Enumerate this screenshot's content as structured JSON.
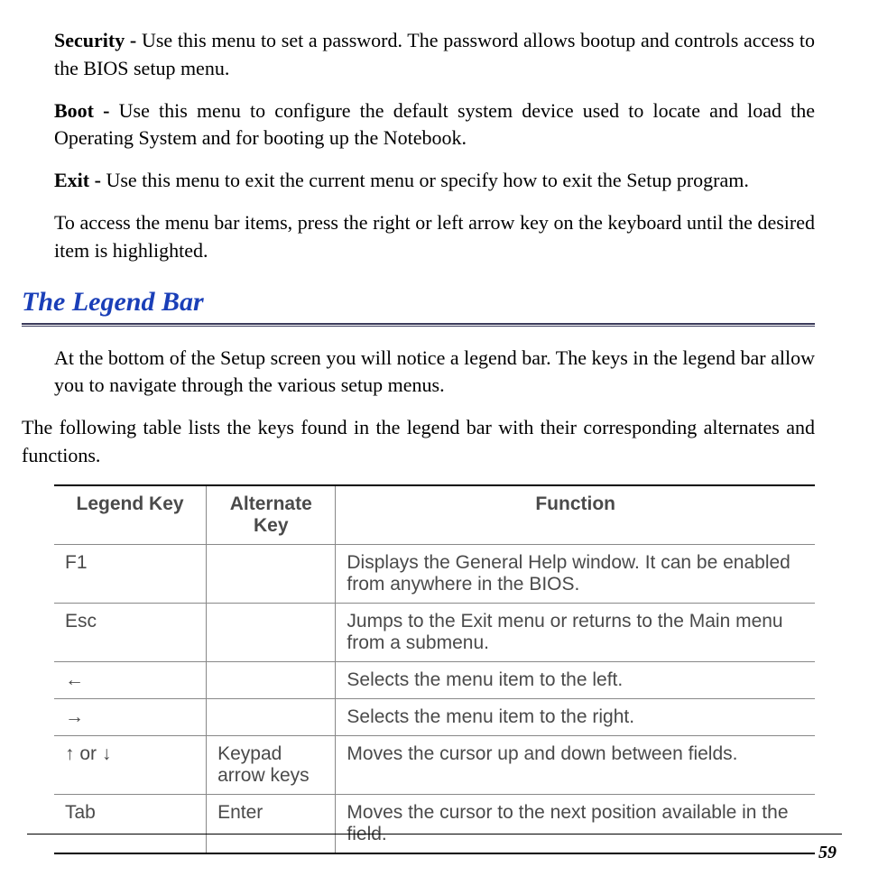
{
  "paragraphs": {
    "security": {
      "label": "Security - ",
      "text": "Use this menu to set a password.  The password allows bootup and controls access to the BIOS setup menu."
    },
    "boot": {
      "label": "Boot - ",
      "text": "Use this menu to configure the default system device used to locate and load the Operating System and for booting up the Notebook."
    },
    "exit": {
      "label": "Exit - ",
      "text": "Use this menu to exit the current menu or specify how to exit the Setup program."
    },
    "access": "To access the menu bar items, press the right or left arrow key on the keyboard until the desired item is highlighted.",
    "legend_intro1": "At the bottom of the Setup screen you will notice a legend bar.  The keys in the legend bar allow you to navigate through the various setup menus.",
    "legend_intro2": "The following table lists the keys found in the legend bar with their corresponding alternates and functions."
  },
  "heading": "The Legend Bar",
  "table": {
    "headers": {
      "legend": "Legend Key",
      "alt": "Alternate Key",
      "func": "Function"
    },
    "rows": [
      {
        "legend": "F1",
        "alt": "",
        "func": "Displays the General Help window.  It can be enabled from anywhere in the BIOS."
      },
      {
        "legend": "Esc",
        "alt": "",
        "func": "Jumps to the Exit menu or returns to the Main menu from a submenu."
      },
      {
        "legend": "←",
        "alt": "",
        "func": "Selects the menu item to the left."
      },
      {
        "legend": "→",
        "alt": "",
        "func": "Selects the menu item to the right."
      },
      {
        "legend": "↑ or ↓",
        "alt": "Keypad arrow keys",
        "func": "Moves the cursor up and down between fields."
      },
      {
        "legend": "Tab",
        "alt": "Enter",
        "func": "Moves the cursor to the next position available in the field."
      }
    ]
  },
  "page_number": "59"
}
